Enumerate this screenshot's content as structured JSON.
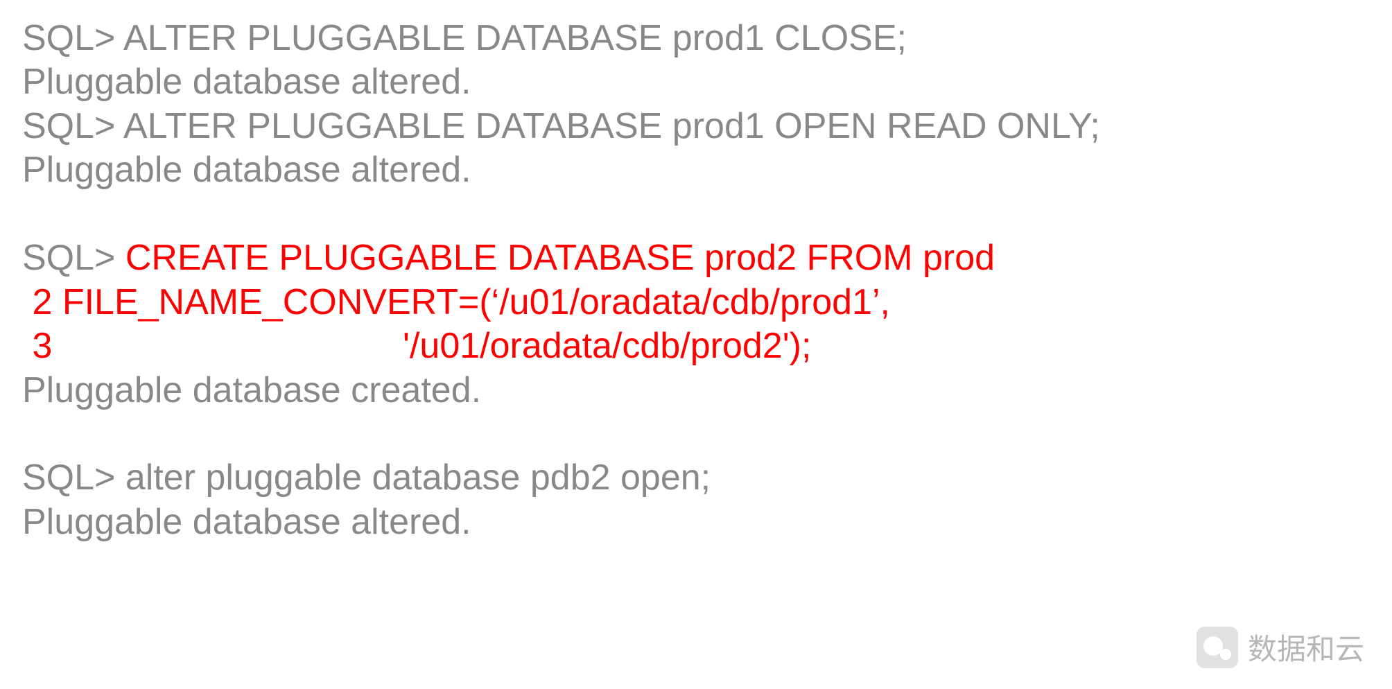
{
  "lines": [
    {
      "text": "SQL> ALTER PLUGGABLE DATABASE prod1 CLOSE;",
      "color": "gray"
    },
    {
      "text": "Pluggable database altered.",
      "color": "gray"
    },
    {
      "text": "SQL> ALTER PLUGGABLE DATABASE prod1 OPEN READ ONLY;",
      "color": "gray"
    },
    {
      "text": "Pluggable database altered.",
      "color": "gray"
    },
    {
      "text": "",
      "color": "gray"
    },
    {
      "prefix": "SQL> ",
      "text": "CREATE PLUGGABLE DATABASE prod2 FROM prod",
      "color": "red"
    },
    {
      "text": " 2 FILE_NAME_CONVERT=(‘/u01/oradata/cdb/prod1’,",
      "color": "red"
    },
    {
      "text": " 3                                   '/u01/oradata/cdb/prod2');",
      "color": "red"
    },
    {
      "text": "Pluggable database created.",
      "color": "gray"
    },
    {
      "text": "",
      "color": "gray"
    },
    {
      "text": "SQL> alter pluggable database pdb2 open;",
      "color": "gray"
    },
    {
      "text": "Pluggable database altered.",
      "color": "gray"
    }
  ],
  "watermark": "数据和云"
}
